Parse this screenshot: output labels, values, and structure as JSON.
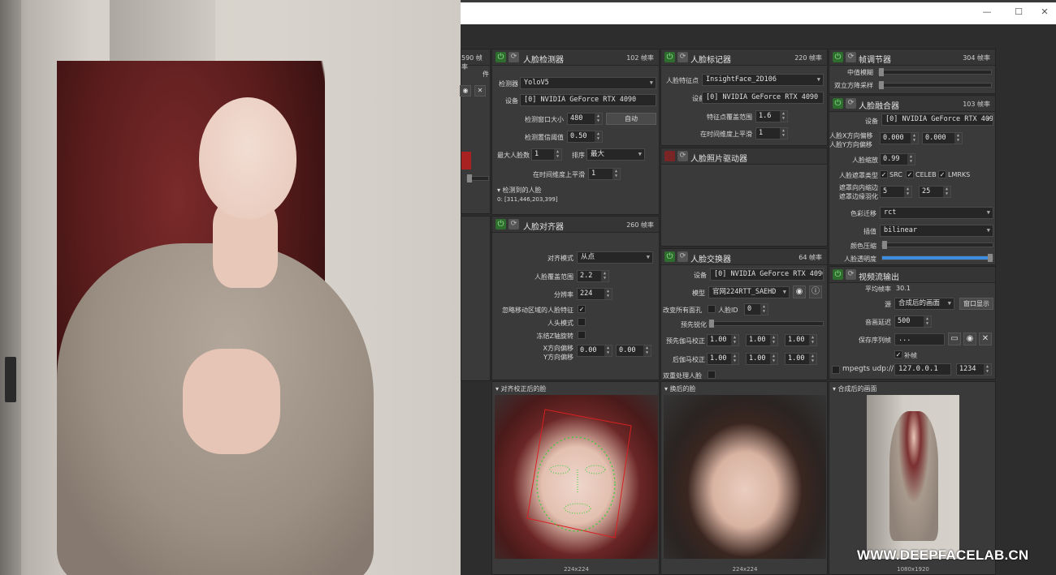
{
  "window": {
    "buttons": [
      "—",
      "☐",
      "✕"
    ]
  },
  "left_panel_partial": {
    "fps": "590 帧率",
    "label": "件"
  },
  "face_detector": {
    "title": "人脸检测器",
    "fps": "102 帧率",
    "detector_label": "检测器",
    "detector_value": "YoloV5",
    "device_label": "设备",
    "device_value": "[0] NVIDIA GeForce RTX 4090",
    "window_size_label": "检测窗口大小",
    "window_size_value": "480",
    "auto_label": "自动",
    "threshold_label": "检测置信阈值",
    "threshold_value": "0.50",
    "max_faces_label": "最大人脸数",
    "max_faces_value": "1",
    "sort_label": "排序",
    "sort_value": "最大",
    "smooth_label": "在时间维度上平滑",
    "smooth_value": "1",
    "detected_label": "▾ 检测到的人脸",
    "detected_value": "0: [311,446,203,399]"
  },
  "face_marker": {
    "title": "人脸标记器",
    "fps": "220 帧率",
    "landmark_label": "人脸特征点",
    "landmark_value": "InsightFace_2D106",
    "device_label": "设备",
    "device_value": "[0] NVIDIA GeForce RTX 4090",
    "range_label": "特征点覆盖范围",
    "range_value": "1.6",
    "smooth_label": "在时间维度上平滑",
    "smooth_value": "1"
  },
  "frame_adjuster": {
    "title": "帧调节器",
    "fps": "304 帧率",
    "median_label": "中值模糊",
    "bilateral_label": "双立方降采样"
  },
  "face_merger": {
    "title": "人脸融合器",
    "fps": "103 帧率",
    "device_label": "设备",
    "device_value": "[0] NVIDIA GeForce RTX 4090",
    "xoffset_label": "人脸X方向偏移",
    "yoffset_label": "人脸Y方向偏移",
    "xoffset_value": "0.000",
    "yoffset_value": "0.000",
    "scale_label": "人脸缩放",
    "scale_value": "0.99",
    "mask_type_label": "人脸遮罩类型",
    "mask_src": "SRC",
    "mask_celeb": "CELEB",
    "mask_lmrks": "LMRKS",
    "erode_label": "遮罩向内缩边",
    "blur_label": "遮罩边缘羽化",
    "erode_value": "5",
    "blur_value": "25",
    "color_label": "色彩迁移",
    "color_value": "rct",
    "interp_label": "插值",
    "interp_value": "bilinear",
    "compress_label": "颜色压缩",
    "opacity_label": "人脸透明度"
  },
  "face_aligner": {
    "title": "人脸对齐器",
    "fps": "260 帧率",
    "mode_label": "对齐模式",
    "mode_value": "从点",
    "coverage_label": "人脸覆盖范围",
    "coverage_value": "2.2",
    "resolution_label": "分辨率",
    "resolution_value": "224",
    "exclude_label": "忽略移动区域的人脸特征",
    "head_mode_label": "人头模式",
    "freeze_label": "冻结Z轴旋转",
    "xshift_label": "X方向偏移",
    "yshift_label": "Y方向偏移",
    "xshift_value": "0.00",
    "yshift_value": "0.00"
  },
  "face_animator": {
    "title": "人脸照片驱动器"
  },
  "face_swapper": {
    "title": "人脸交换器",
    "fps": "64 帧率",
    "device_label": "设备",
    "device_value": "[0] NVIDIA GeForce RTX 4090",
    "model_label": "模型",
    "model_value": "官网224RTT_SAEHD",
    "swap_all_label": "改变所有面孔",
    "face_id_label": "人脸ID",
    "face_id_value": "0",
    "presharpen_label": "预先锐化",
    "pre_gamma_label": "预先伽马校正",
    "post_gamma_label": "后伽马校正",
    "pre_gamma": [
      "1.00",
      "1.00",
      "1.00"
    ],
    "post_gamma": [
      "1.00",
      "1.00",
      "1.00"
    ],
    "two_pass_label": "双重处理人脸"
  },
  "stream_output": {
    "title": "视频流输出",
    "avg_fps_label": "平均帧率",
    "avg_fps_value": "30.1",
    "source_label": "源",
    "source_value": "合成后的画面",
    "window_button": "窗口显示",
    "delay_label": "音画延迟",
    "delay_value": "500",
    "save_seq_label": "保存序列帧",
    "save_seq_value": "...",
    "fill_frames_label": "补帧",
    "mpegts_label": "mpegts udp://",
    "ip_value": "127.0.0.1",
    "port_value": "1234"
  },
  "previews": {
    "aligned_title": "▾ 对齐校正后的脸",
    "aligned_res": "224x224",
    "swapped_title": "▾ 换后的脸",
    "swapped_res": "224x224",
    "merged_title": "▾ 合成后的画面",
    "merged_res": "1080x1920"
  },
  "watermark": "WWW.DEEPFACELAB.CN"
}
